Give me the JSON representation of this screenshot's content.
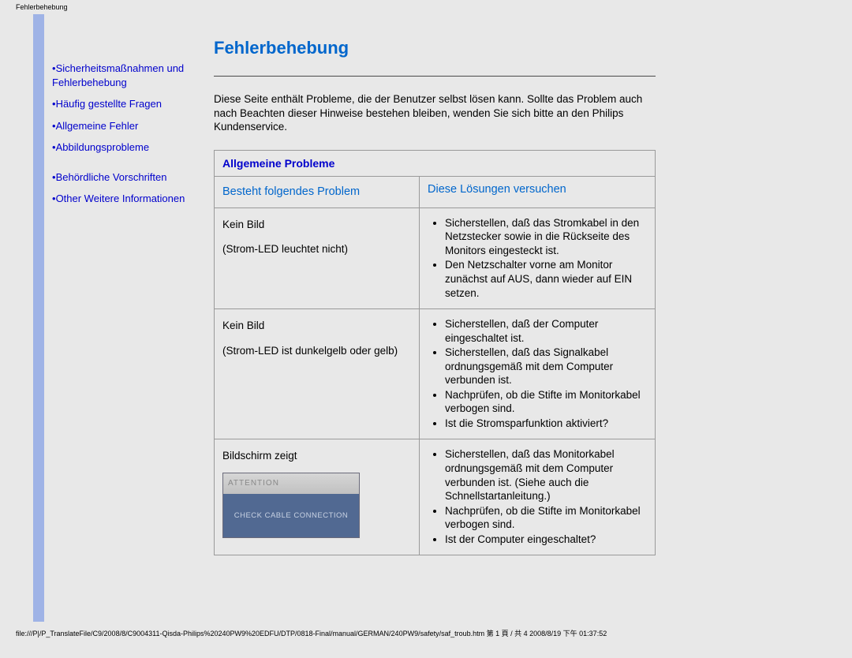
{
  "page_title_tiny": "Fehlerbehebung",
  "sidebar": {
    "items": [
      "Sicherheitsmaßnahmen und Fehlerbehebung",
      "Häufig gestellte Fragen",
      "Allgemeine Fehler",
      "Abbildungsprobleme",
      "Behördliche Vorschriften",
      "Other Weitere Informationen"
    ]
  },
  "main": {
    "heading": "Fehlerbehebung",
    "intro": "Diese Seite enthält Probleme, die der Benutzer selbst lösen kann. Sollte das Problem auch nach Beachten dieser Hinweise bestehen bleiben, wenden Sie sich bitte an den Philips Kundenservice.",
    "table_title": "Allgemeine Probleme",
    "col1_header": "Besteht folgendes Problem",
    "col2_header": "Diese Lösungen versuchen",
    "rows": [
      {
        "problem_line1": "Kein Bild",
        "problem_line2": "(Strom-LED leuchtet nicht)",
        "solutions": [
          "Sicherstellen, daß das Stromkabel in den Netzstecker sowie in die Rückseite des Monitors eingesteckt ist.",
          "Den Netzschalter vorne am Monitor zunächst auf AUS, dann wieder auf EIN setzen."
        ]
      },
      {
        "problem_line1": "Kein Bild",
        "problem_line2": "(Strom-LED ist dunkelgelb oder gelb)",
        "solutions": [
          "Sicherstellen, daß der Computer eingeschaltet ist.",
          "Sicherstellen, daß das Signalkabel ordnungsgemäß mit dem Computer verbunden ist.",
          "Nachprüfen, ob die Stifte im Monitorkabel verbogen sind.",
          "Ist die Stromsparfunktion aktiviert?"
        ]
      },
      {
        "problem_line1": "Bildschirm zeigt",
        "monitor_top": "ATTENTION",
        "monitor_body": "CHECK CABLE CONNECTION",
        "solutions": [
          "Sicherstellen, daß das Monitorkabel ordnungsgemäß mit dem Computer verbunden ist. (Siehe auch die Schnellstartanleitung.)",
          "Nachprüfen, ob die Stifte im Monitorkabel verbogen sind.",
          "Ist der Computer eingeschaltet?"
        ]
      }
    ]
  },
  "footer_path": "file:///P|/P_TranslateFile/C9/2008/8/C9004311-Qisda-Philips%20240PW9%20EDFU/DTP/0818-Final/manual/GERMAN/240PW9/safety/saf_troub.htm 第 1 頁 / 共 4 2008/8/19 下午 01:37:52"
}
